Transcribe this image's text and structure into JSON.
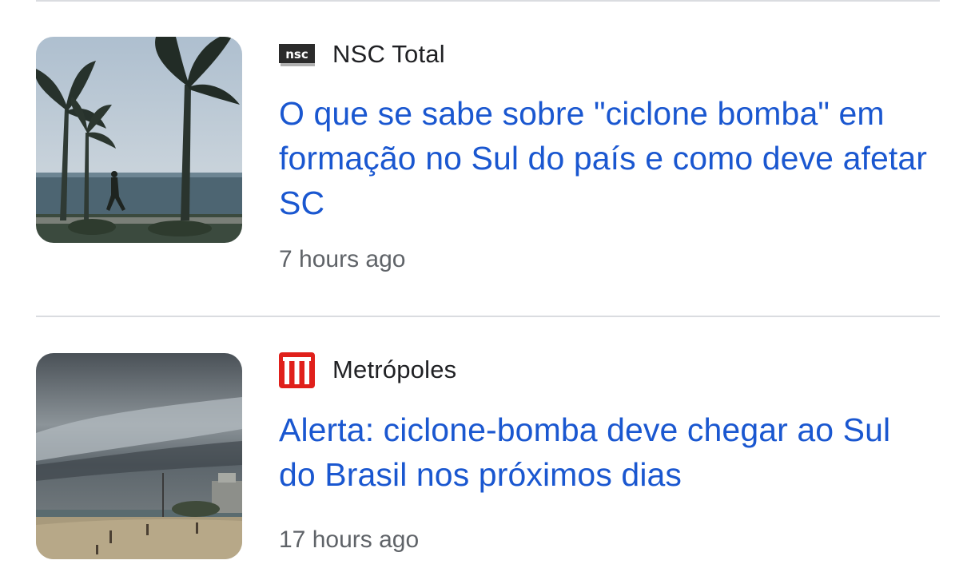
{
  "articles": [
    {
      "source": "NSC Total",
      "source_logo_text": "nsc",
      "source_logo_icon": "nsc-logo-icon",
      "headline": "O que se sabe sobre \"ciclone bomba\" em formação no Sul do país e como deve afetar SC",
      "time": "7 hours ago",
      "thumbnail": "palm-trees-seaside-thumbnail"
    },
    {
      "source": "Metrópoles",
      "source_logo_text": "M",
      "source_logo_icon": "metropoles-logo-icon",
      "headline": "Alerta: ciclone-bomba deve chegar ao Sul do Brasil nos próximos dias",
      "time": "17 hours ago",
      "thumbnail": "stormy-beach-thumbnail"
    }
  ],
  "colors": {
    "headline": "#1a57d0",
    "source": "#202124",
    "time": "#5f6368",
    "divider": "#dadce0",
    "metropoles_red": "#e0201b"
  }
}
